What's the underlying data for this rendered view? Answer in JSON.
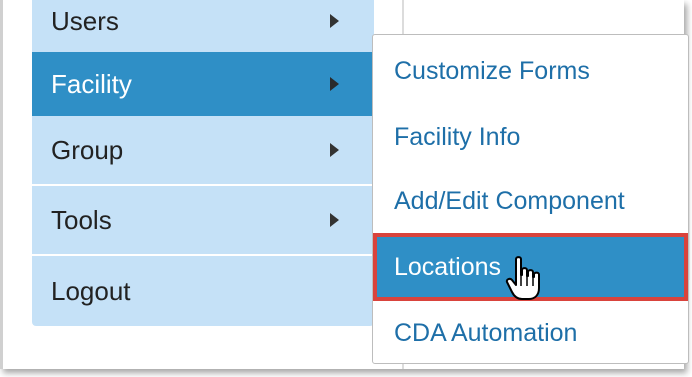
{
  "side_menu": {
    "items": [
      {
        "label": "Users"
      },
      {
        "label": "Facility"
      },
      {
        "label": "Group"
      },
      {
        "label": "Tools"
      },
      {
        "label": "Logout"
      }
    ]
  },
  "submenu": {
    "items": [
      {
        "label": "Customize Forms"
      },
      {
        "label": "Facility Info"
      },
      {
        "label": "Add/Edit Component"
      },
      {
        "label": "Locations"
      },
      {
        "label": "CDA Automation"
      }
    ]
  },
  "colors": {
    "menu_bg": "#c5e1f7",
    "active_bg": "#2f8fc6",
    "highlight_border": "#d9433c",
    "submenu_text": "#1e6fa8"
  },
  "icons": [
    "chevron-right-icon",
    "hand-pointer-cursor-icon"
  ]
}
